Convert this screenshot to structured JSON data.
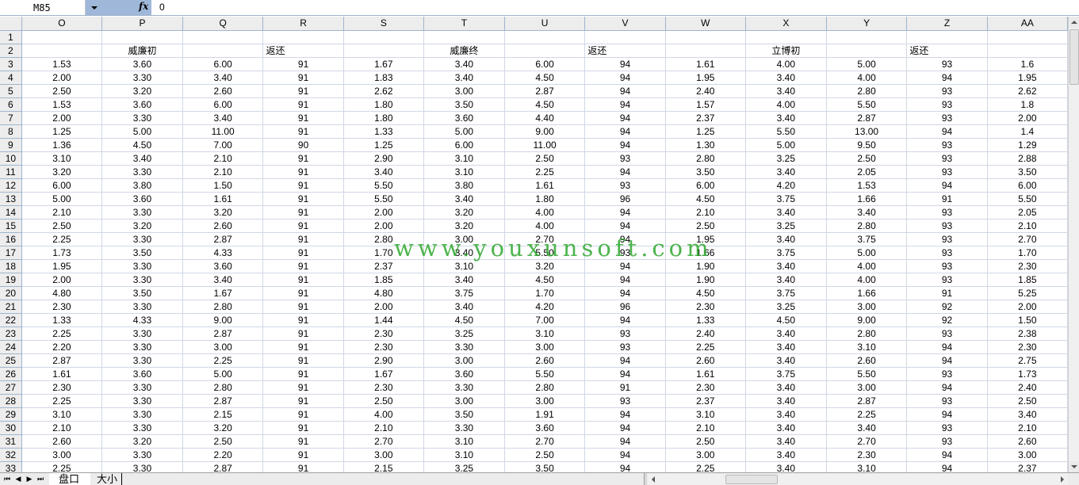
{
  "formula_bar": {
    "name_box": "M85",
    "fx_label": "fx",
    "value": "0"
  },
  "columns": [
    "O",
    "P",
    "Q",
    "R",
    "S",
    "T",
    "U",
    "V",
    "W",
    "X",
    "Y",
    "Z",
    "AA"
  ],
  "row2": {
    "P": "威廉初",
    "R": "返还",
    "T": "威廉终",
    "V": "返还",
    "X": "立博初",
    "Z": "返还"
  },
  "rows": [
    {
      "n": "1",
      "c": [
        "",
        "",
        "",
        "",
        "",
        "",
        "",
        "",
        "",
        "",
        "",
        "",
        ""
      ]
    },
    {
      "n": "2",
      "c": [
        "",
        "",
        "",
        "",
        "",
        "",
        "",
        "",
        "",
        "",
        "",
        "",
        ""
      ]
    },
    {
      "n": "3",
      "c": [
        "1.53",
        "3.60",
        "6.00",
        "91",
        "1.67",
        "3.40",
        "6.00",
        "94",
        "1.61",
        "4.00",
        "5.00",
        "93",
        "1.6"
      ]
    },
    {
      "n": "4",
      "c": [
        "2.00",
        "3.30",
        "3.40",
        "91",
        "1.83",
        "3.40",
        "4.50",
        "94",
        "1.95",
        "3.40",
        "4.00",
        "94",
        "1.95"
      ]
    },
    {
      "n": "5",
      "c": [
        "2.50",
        "3.20",
        "2.60",
        "91",
        "2.62",
        "3.00",
        "2.87",
        "94",
        "2.40",
        "3.40",
        "2.80",
        "93",
        "2.62"
      ]
    },
    {
      "n": "6",
      "c": [
        "1.53",
        "3.60",
        "6.00",
        "91",
        "1.80",
        "3.50",
        "4.50",
        "94",
        "1.57",
        "4.00",
        "5.50",
        "93",
        "1.8"
      ]
    },
    {
      "n": "7",
      "c": [
        "2.00",
        "3.30",
        "3.40",
        "91",
        "1.80",
        "3.60",
        "4.40",
        "94",
        "2.37",
        "3.40",
        "2.87",
        "93",
        "2.00"
      ]
    },
    {
      "n": "8",
      "c": [
        "1.25",
        "5.00",
        "11.00",
        "91",
        "1.33",
        "5.00",
        "9.00",
        "94",
        "1.25",
        "5.50",
        "13.00",
        "94",
        "1.4"
      ]
    },
    {
      "n": "9",
      "c": [
        "1.36",
        "4.50",
        "7.00",
        "90",
        "1.25",
        "6.00",
        "11.00",
        "94",
        "1.30",
        "5.00",
        "9.50",
        "93",
        "1.29"
      ]
    },
    {
      "n": "10",
      "c": [
        "3.10",
        "3.40",
        "2.10",
        "91",
        "2.90",
        "3.10",
        "2.50",
        "93",
        "2.80",
        "3.25",
        "2.50",
        "93",
        "2.88"
      ]
    },
    {
      "n": "11",
      "c": [
        "3.20",
        "3.30",
        "2.10",
        "91",
        "3.40",
        "3.10",
        "2.25",
        "94",
        "3.50",
        "3.40",
        "2.05",
        "93",
        "3.50"
      ]
    },
    {
      "n": "12",
      "c": [
        "6.00",
        "3.80",
        "1.50",
        "91",
        "5.50",
        "3.80",
        "1.61",
        "93",
        "6.00",
        "4.20",
        "1.53",
        "94",
        "6.00"
      ]
    },
    {
      "n": "13",
      "c": [
        "5.00",
        "3.60",
        "1.61",
        "91",
        "5.50",
        "3.40",
        "1.80",
        "96",
        "4.50",
        "3.75",
        "1.66",
        "91",
        "5.50"
      ]
    },
    {
      "n": "14",
      "c": [
        "2.10",
        "3.30",
        "3.20",
        "91",
        "2.00",
        "3.20",
        "4.00",
        "94",
        "2.10",
        "3.40",
        "3.40",
        "93",
        "2.05"
      ]
    },
    {
      "n": "15",
      "c": [
        "2.50",
        "3.20",
        "2.60",
        "91",
        "2.00",
        "3.20",
        "4.00",
        "94",
        "2.50",
        "3.25",
        "2.80",
        "93",
        "2.10"
      ]
    },
    {
      "n": "16",
      "c": [
        "2.25",
        "3.30",
        "2.87",
        "91",
        "2.80",
        "3.00",
        "2.70",
        "94",
        "1.95",
        "3.40",
        "3.75",
        "93",
        "2.70"
      ]
    },
    {
      "n": "17",
      "c": [
        "1.73",
        "3.50",
        "4.33",
        "91",
        "1.70",
        "3.40",
        "5.50",
        "93",
        "1.66",
        "3.75",
        "5.00",
        "93",
        "1.70"
      ]
    },
    {
      "n": "18",
      "c": [
        "1.95",
        "3.30",
        "3.60",
        "91",
        "2.37",
        "3.10",
        "3.20",
        "94",
        "1.90",
        "3.40",
        "4.00",
        "93",
        "2.30"
      ]
    },
    {
      "n": "19",
      "c": [
        "2.00",
        "3.30",
        "3.40",
        "91",
        "1.85",
        "3.40",
        "4.50",
        "94",
        "1.90",
        "3.40",
        "4.00",
        "93",
        "1.85"
      ]
    },
    {
      "n": "20",
      "c": [
        "4.80",
        "3.50",
        "1.67",
        "91",
        "4.80",
        "3.75",
        "1.70",
        "94",
        "4.50",
        "3.75",
        "1.66",
        "91",
        "5.25"
      ]
    },
    {
      "n": "21",
      "c": [
        "2.30",
        "3.30",
        "2.80",
        "91",
        "2.00",
        "3.40",
        "4.20",
        "96",
        "2.30",
        "3.25",
        "3.00",
        "92",
        "2.00"
      ]
    },
    {
      "n": "22",
      "c": [
        "1.33",
        "4.33",
        "9.00",
        "91",
        "1.44",
        "4.50",
        "7.00",
        "94",
        "1.33",
        "4.50",
        "9.00",
        "92",
        "1.50"
      ]
    },
    {
      "n": "23",
      "c": [
        "2.25",
        "3.30",
        "2.87",
        "91",
        "2.30",
        "3.25",
        "3.10",
        "93",
        "2.40",
        "3.40",
        "2.80",
        "93",
        "2.38"
      ]
    },
    {
      "n": "24",
      "c": [
        "2.20",
        "3.30",
        "3.00",
        "91",
        "2.30",
        "3.30",
        "3.00",
        "93",
        "2.25",
        "3.40",
        "3.10",
        "94",
        "2.30"
      ]
    },
    {
      "n": "25",
      "c": [
        "2.87",
        "3.30",
        "2.25",
        "91",
        "2.90",
        "3.00",
        "2.60",
        "94",
        "2.60",
        "3.40",
        "2.60",
        "94",
        "2.75"
      ]
    },
    {
      "n": "26",
      "c": [
        "1.61",
        "3.60",
        "5.00",
        "91",
        "1.67",
        "3.60",
        "5.50",
        "94",
        "1.61",
        "3.75",
        "5.50",
        "93",
        "1.73"
      ]
    },
    {
      "n": "27",
      "c": [
        "2.30",
        "3.30",
        "2.80",
        "91",
        "2.30",
        "3.30",
        "2.80",
        "91",
        "2.30",
        "3.40",
        "3.00",
        "94",
        "2.40"
      ]
    },
    {
      "n": "28",
      "c": [
        "2.25",
        "3.30",
        "2.87",
        "91",
        "2.50",
        "3.00",
        "3.00",
        "93",
        "2.37",
        "3.40",
        "2.87",
        "93",
        "2.50"
      ]
    },
    {
      "n": "29",
      "c": [
        "3.10",
        "3.30",
        "2.15",
        "91",
        "4.00",
        "3.50",
        "1.91",
        "94",
        "3.10",
        "3.40",
        "2.25",
        "94",
        "3.40"
      ]
    },
    {
      "n": "30",
      "c": [
        "2.10",
        "3.30",
        "3.20",
        "91",
        "2.10",
        "3.30",
        "3.60",
        "94",
        "2.10",
        "3.40",
        "3.40",
        "93",
        "2.10"
      ]
    },
    {
      "n": "31",
      "c": [
        "2.60",
        "3.20",
        "2.50",
        "91",
        "2.70",
        "3.10",
        "2.70",
        "94",
        "2.50",
        "3.40",
        "2.70",
        "93",
        "2.60"
      ]
    },
    {
      "n": "32",
      "c": [
        "3.00",
        "3.30",
        "2.20",
        "91",
        "3.00",
        "3.10",
        "2.50",
        "94",
        "3.00",
        "3.40",
        "2.30",
        "94",
        "3.00"
      ]
    },
    {
      "n": "33",
      "c": [
        "2.25",
        "3.30",
        "2.87",
        "91",
        "2.15",
        "3.25",
        "3.50",
        "94",
        "2.25",
        "3.40",
        "3.10",
        "94",
        "2.37"
      ]
    }
  ],
  "sheet_tabs": [
    "盘口",
    "大小"
  ],
  "nav_buttons": [
    "⏮",
    "◀",
    "▶",
    "⏭"
  ],
  "watermark": "www.youxunsoft.com",
  "colors": {
    "header_bg": "#ededed",
    "grid_line": "#d0d7e5",
    "watermark": "#2ea82e",
    "toolbar_blue": "#9fb7d8"
  }
}
